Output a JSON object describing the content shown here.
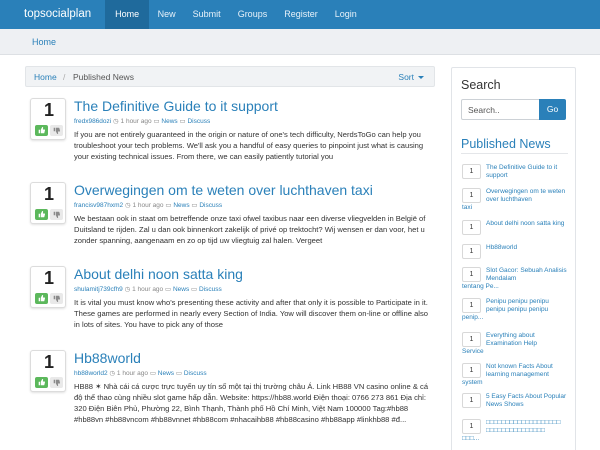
{
  "nav": {
    "brand": "topsocialplan",
    "items": [
      "Home",
      "New",
      "Submit",
      "Groups",
      "Register",
      "Login"
    ]
  },
  "crumb_strip": {
    "home": "Home"
  },
  "main": {
    "breadcrumb_home": "Home",
    "breadcrumb_sep": "/",
    "breadcrumb_current": "Published News",
    "sort_label": "Sort"
  },
  "posts": [
    {
      "votes": "1",
      "title": "The Definitive Guide to it support",
      "author": "fredx986dozi",
      "time": "1 hour ago",
      "category": "News",
      "discuss": "Discuss",
      "body": "If you are not entirely guaranteed in the origin or nature of one's tech difficulty, NerdsToGo can help you troubleshoot your tech problems. We'll ask you a handful of easy queries to pinpoint just what is causing your existing technical issues. From there, we can easily patiently tutorial you"
    },
    {
      "votes": "1",
      "title": "Overwegingen om te weten over luchthaven taxi",
      "author": "francisv987hxm2",
      "time": "1 hour ago",
      "category": "News",
      "discuss": "Discuss",
      "body": "We bestaan ook in staat om betreffende onze taxi ofwel taxibus naar een diverse vliegvelden in België of Duitsland te rijden. Zal u dan ook binnenkort zakelijk of privé op trektocht? Wij wensen er dan voor, het u zonder spanning, aangenaam en zo op tijd uw vliegtuig zal halen. Vergeet"
    },
    {
      "votes": "1",
      "title": "About delhi noon satta king",
      "author": "shulamitj739cfh9",
      "time": "1 hour ago",
      "category": "News",
      "discuss": "Discuss",
      "body": "It is vital you must know who's presenting these activity and after that only it is possible to Participate in it. These games are performed in nearly every Section of India. Yow will discover them on-line or offline also in lots of sites. You have to pick any of those"
    },
    {
      "votes": "1",
      "title": "Hb88world",
      "author": "hb88world2",
      "time": "1 hour ago",
      "category": "News",
      "discuss": "Discuss",
      "body": "HB88 ✶ Nhà cái cá cược trực tuyến uy tín số một tại thị trường châu Á. Link HB88 VN casino online & cá độ thể thao cùng nhiều slot game hấp dẫn. Website: https://hb88.world Điện thoại: 0766 273 861 Địa chỉ: 320 Điện Biên Phủ, Phường 22, Bình Thạnh, Thành phố Hồ Chí Minh, Việt Nam 100000 Tag:#hb88 #hb88vn #hb88vncom #hb88vnnet #hb88com #nhacaihb88 #hb88casino #hb88app #linkhb88 #đ..."
    }
  ],
  "sidebar": {
    "search_title": "Search",
    "search_placeholder": "Search..",
    "go_label": "Go",
    "published_title": "Published News",
    "items": [
      {
        "votes": "1",
        "label": "The Definitive Guide to it support",
        "spill": ""
      },
      {
        "votes": "1",
        "label": "Overwegingen om te weten over luchthaven",
        "spill": "taxi"
      },
      {
        "votes": "1",
        "label": "About delhi noon satta king",
        "spill": ""
      },
      {
        "votes": "1",
        "label": "Hb88world",
        "spill": ""
      },
      {
        "votes": "1",
        "label": "Slot Gacor: Sebuah Analisis Mendalam",
        "spill": "tentang Pe..."
      },
      {
        "votes": "1",
        "label": "Penipu penipu penipu penipu penipu penipu",
        "spill": "penip..."
      },
      {
        "votes": "1",
        "label": "Everything about Examination Help",
        "spill": "Service"
      },
      {
        "votes": "1",
        "label": "Not known Facts About learning management",
        "spill": "system"
      },
      {
        "votes": "1",
        "label": "5 Easy Facts About Popular News Shows",
        "spill": ""
      },
      {
        "votes": "1",
        "label": "□□□□□□□□□□□□□□□□□□□ □□□□□□□□□□□□□□□",
        "spill": "□□□..."
      }
    ]
  },
  "colors": {
    "accent": "#2a80b9",
    "upvote": "#5cb85c"
  }
}
